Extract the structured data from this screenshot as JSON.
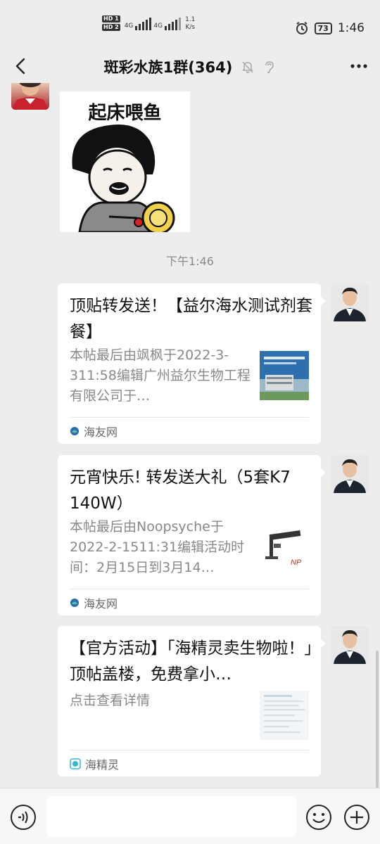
{
  "status_bar": {
    "hd1": "HD 1",
    "hd2": "HD 2",
    "net1": "4G",
    "net2": "4G",
    "speed_value": "1.1",
    "speed_unit": "K/s",
    "battery": "73",
    "time": "1:46"
  },
  "nav": {
    "title": "斑彩水族1群(364)"
  },
  "chat": {
    "sticker_text": "起床喂鱼",
    "time_label": "下午1:46",
    "cards": [
      {
        "title": "顶贴转发送！【益尔海水测试剂套餐】",
        "desc": "本帖最后由飒枫于2022-3-311:58编辑广州益尔生物工程有限公司于…",
        "source": "海友网",
        "thumb_caption": "益尔生物"
      },
      {
        "title": "元宵快乐! 转发送大礼（5套K7 140W）",
        "desc": "本帖最后由Noopsyche于2022-2-1511:31编辑活动时间：2月15日到3月14…",
        "source": "海友网",
        "thumb_caption": "NP"
      },
      {
        "title": "【官方活动】「海精灵卖生物啦！」顶帖盖楼，免费拿小…",
        "desc": "点击查看详情",
        "source": "海精灵",
        "thumb_caption": ""
      }
    ]
  },
  "colors": {
    "background": "#ededed",
    "card": "#ffffff",
    "muted_text": "#888888",
    "source_icon_blue": "#2b6cb0",
    "source_icon_cyan": "#36b5d8"
  },
  "icons": {
    "back": "chevron-left-icon",
    "mute": "bell-off-icon",
    "ear": "earpiece-icon",
    "more": "more-dots-icon",
    "voice": "voice-icon",
    "emoji": "emoji-icon",
    "plus": "plus-icon"
  }
}
